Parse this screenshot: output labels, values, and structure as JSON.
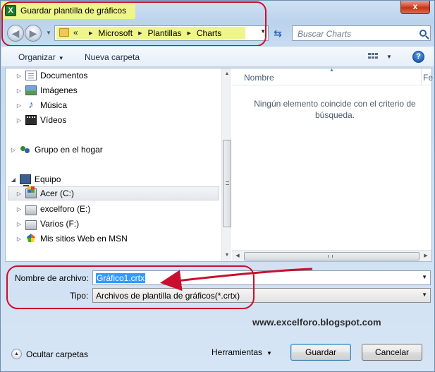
{
  "window": {
    "title": "Guardar plantilla de gráficos",
    "app_icon_glyph": "X",
    "close_glyph": "x"
  },
  "nav": {
    "back_glyph": "◀",
    "forward_glyph": "▶",
    "overflow_glyph": "«",
    "breadcrumbs": [
      "Microsoft",
      "Plantillas",
      "Charts"
    ],
    "search_placeholder": "Buscar Charts"
  },
  "toolbar": {
    "organize_label": "Organizar",
    "new_folder_label": "Nueva carpeta",
    "help_glyph": "?"
  },
  "tree": {
    "items": [
      {
        "label": "Documentos",
        "icon": "documents-icon"
      },
      {
        "label": "Imágenes",
        "icon": "pictures-icon"
      },
      {
        "label": "Música",
        "icon": "music-icon"
      },
      {
        "label": "Vídeos",
        "icon": "videos-icon"
      },
      {
        "label": "Grupo en el hogar",
        "icon": "homegroup-icon"
      },
      {
        "label": "Equipo",
        "icon": "computer-icon"
      },
      {
        "label": "Acer (C:)",
        "icon": "drive-c-icon"
      },
      {
        "label": "excelforo (E:)",
        "icon": "drive-icon"
      },
      {
        "label": "Varios (F:)",
        "icon": "drive-icon"
      },
      {
        "label": "Mis sitios Web en MSN",
        "icon": "msn-icon"
      }
    ]
  },
  "files": {
    "column_name": "Nombre",
    "column_next": "Fe",
    "empty_message": "Ningún elemento coincide con el criterio de búsqueda."
  },
  "form": {
    "filename_label": "Nombre de archivo:",
    "filename_value": "Gráfico1.crtx",
    "type_label": "Tipo:",
    "type_value": "Archivos de plantilla de gráficos(*.crtx)"
  },
  "watermark": "www.excelforo.blogspot.com",
  "footer": {
    "hide_folders_label": "Ocultar carpetas",
    "tools_label": "Herramientas",
    "save_label": "Guardar",
    "cancel_label": "Cancelar"
  },
  "colors": {
    "highlight_red": "#c8102e",
    "highlight_yellow": "#eef58a",
    "selection_blue": "#3399ff"
  }
}
